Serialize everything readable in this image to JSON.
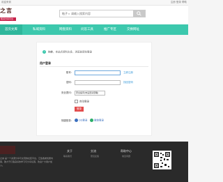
{
  "topbar": {
    "welcome": "欢迎来到",
    "links": "注册 登录 帮助"
  },
  "header": {
    "logo_text": "之言",
    "logo_sub": "知识分享平台",
    "search_scope": "帖子",
    "search_placeholder": "请输入搜索内容"
  },
  "nav": {
    "items": [
      {
        "label": "首页文库",
        "active": true
      },
      {
        "label": "私域资料"
      },
      {
        "label": "网盘资料"
      },
      {
        "label": "问答工具"
      },
      {
        "label": "推广专区"
      },
      {
        "label": "交换网址"
      }
    ]
  },
  "login": {
    "notice": "抱歉，本站点资料太多，浏览前请先登录",
    "title": "用户登录",
    "username_label": "账号:",
    "username_hint": "立即注册",
    "password_label": "密码:",
    "password_hint": "找回密码",
    "security_label": "安全提问:",
    "security_value": "安全提问(未设置请忽略)",
    "remember_label": "自动登录",
    "submit_label": "登录",
    "quick_label": "快捷登录:",
    "quick_qq": "QQ登录",
    "quick_wechat": "微信登录"
  },
  "footer": {
    "about": "之言 是一个资源分享与交流的社区平台，汇集各类优质内容，致力于打造良好的学习与分享氛围，欢迎广大用户加入。",
    "col1_title": "关于",
    "col1_link": "联系我们",
    "col2_title": "交流",
    "col2_link": "意见反馈",
    "col3_title": "帮助中心",
    "col3_link": "常见问题"
  },
  "colors": {
    "nav": "#3cc8ad",
    "brand": "#c8224a",
    "login_button": "#e24a4a",
    "footer": "#2a2a2a"
  }
}
